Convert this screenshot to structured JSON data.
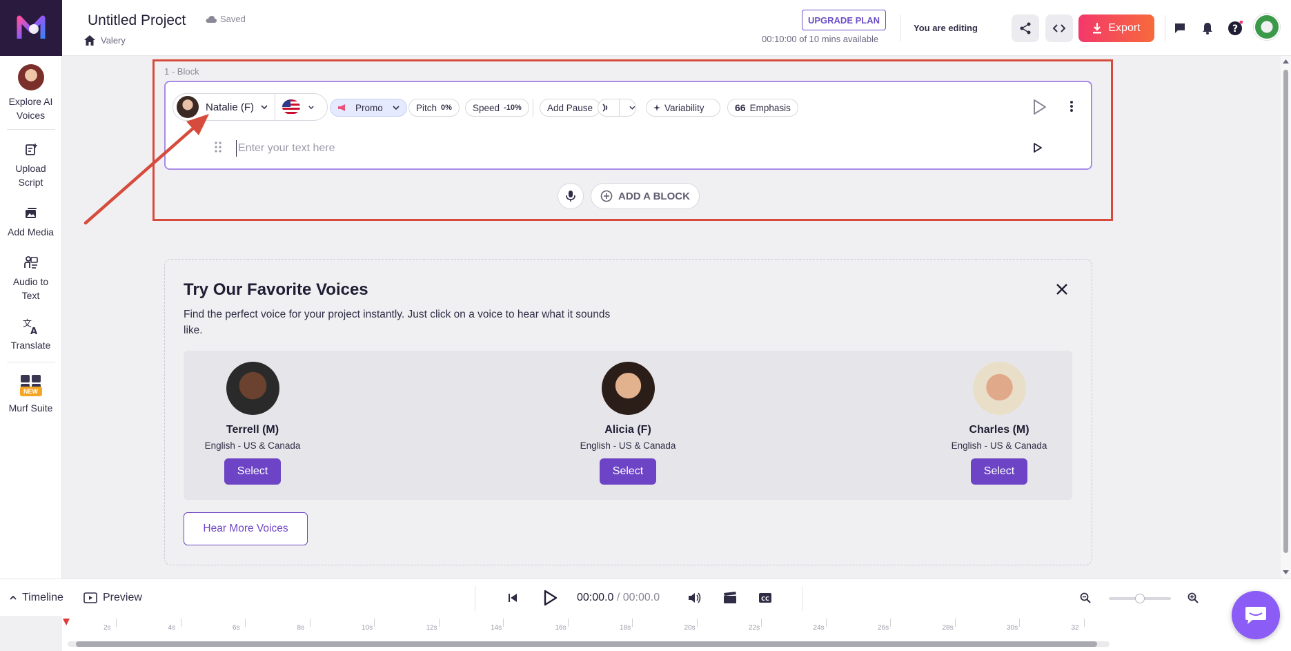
{
  "header": {
    "project_title": "Untitled Project",
    "saved_status": "Saved",
    "breadcrumb": "Valery",
    "upgrade_label": "UPGRADE PLAN",
    "minutes_available": "00:10:00 of 10 mins available",
    "editing_status": "You are editing",
    "export_label": "Export"
  },
  "sidebar": {
    "items": [
      {
        "label": "Explore AI Voices",
        "icon": "voice-avatar"
      },
      {
        "label": "Upload Script",
        "icon": "upload-script-icon"
      },
      {
        "label": "Add Media",
        "icon": "add-media-icon"
      },
      {
        "label": "Audio to Text",
        "icon": "audio-to-text-icon"
      },
      {
        "label": "Translate",
        "icon": "translate-icon"
      },
      {
        "label": "Murf Suite",
        "icon": "murf-suite-icon",
        "badge": "NEW"
      }
    ]
  },
  "block": {
    "label": "1 -  Block",
    "voice_name": "Natalie (F)",
    "style": "Promo",
    "pitch_label": "Pitch",
    "pitch_value": "0%",
    "speed_label": "Speed",
    "speed_value": "-10%",
    "add_pause_label": "Add Pause",
    "variability_label": "Variability",
    "emphasis_label": "Emphasis",
    "text_placeholder": "Enter your text here",
    "add_block_label": "ADD A BLOCK"
  },
  "favorites": {
    "title": "Try Our Favorite Voices",
    "description": "Find the perfect voice for your project instantly. Just click on a voice to hear what it sounds like.",
    "voices": [
      {
        "name": "Terrell (M)",
        "language": "English - US & Canada",
        "select_label": "Select"
      },
      {
        "name": "Alicia (F)",
        "language": "English - US & Canada",
        "select_label": "Select"
      },
      {
        "name": "Charles (M)",
        "language": "English - US & Canada",
        "select_label": "Select"
      }
    ],
    "hear_more_label": "Hear More Voices"
  },
  "bottom": {
    "timeline_label": "Timeline",
    "preview_label": "Preview",
    "current_time": "00:00.0",
    "separator": " / ",
    "total_time": "00:00.0"
  },
  "timeline": {
    "tick_labels": [
      "2s",
      "4s",
      "6s",
      "8s",
      "10s",
      "12s",
      "14s",
      "16s",
      "18s",
      "20s",
      "22s",
      "24s",
      "26s",
      "28s",
      "30s",
      "32"
    ]
  },
  "colors": {
    "brand_purple": "#6d44c6",
    "export_gradient_start": "#f3386a",
    "export_gradient_end": "#f76a3c",
    "highlight_red": "#d64b3c"
  }
}
